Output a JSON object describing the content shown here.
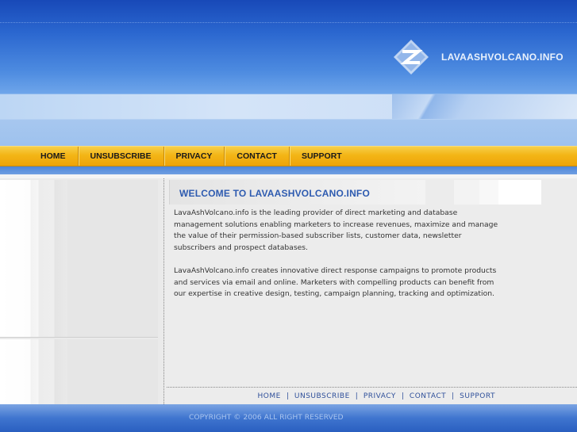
{
  "site": {
    "logo_text": "LAVAASHVOLCANO.INFO",
    "logo_icon": "diamond-z-logo-icon"
  },
  "nav": {
    "items": [
      {
        "label": "HOME"
      },
      {
        "label": "UNSUBSCRIBE"
      },
      {
        "label": "PRIVACY"
      },
      {
        "label": "CONTACT"
      },
      {
        "label": "SUPPORT"
      }
    ]
  },
  "main": {
    "welcome_title": "WELCOME TO LAVAASHVOLCANO.INFO",
    "paragraphs": [
      "LavaAshVolcano.info is the leading provider of direct marketing and database management solutions enabling marketers to increase revenues, maximize and manage the value of their permission-based subscriber lists, customer data, newsletter subscribers and prospect databases.",
      "LavaAshVolcano.info creates innovative direct response campaigns to promote products and services via email and online. Marketers with compelling products can benefit from our expertise in creative design, testing, campaign planning, tracking and optimization."
    ]
  },
  "footer": {
    "links": [
      {
        "label": "HOME"
      },
      {
        "label": "UNSUBSCRIBE"
      },
      {
        "label": "PRIVACY"
      },
      {
        "label": "CONTACT"
      },
      {
        "label": "SUPPORT"
      }
    ],
    "separator": "|",
    "copyright": "COPYRIGHT © 2006 ALL RIGHT RESERVED"
  },
  "colors": {
    "header_blue": "#1849b8",
    "nav_orange": "#f3b516",
    "title_blue": "#2e5bb0",
    "link_blue": "#2e4f9a"
  }
}
